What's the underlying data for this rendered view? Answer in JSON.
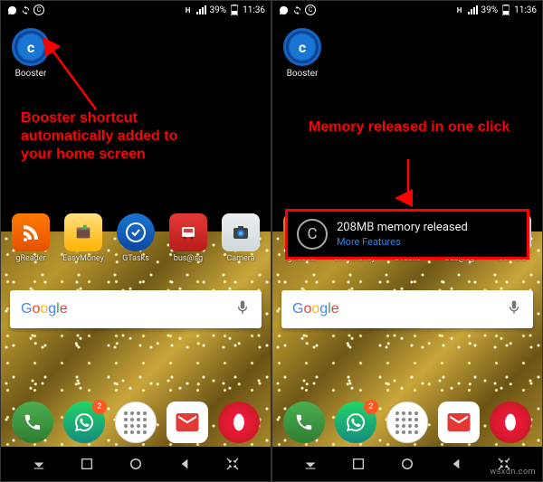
{
  "statusbar": {
    "battery_pct": "39%",
    "time": "11:36"
  },
  "booster": {
    "glyph": "c",
    "label": "Booster"
  },
  "apps": [
    {
      "label": "gReader",
      "class": "greader"
    },
    {
      "label": "EasyMoney",
      "class": "easymoney"
    },
    {
      "label": "GTasks",
      "class": "gtasks"
    },
    {
      "label": "bus@sg",
      "class": "bussg"
    },
    {
      "label": "Camera",
      "class": "camera"
    }
  ],
  "search": {
    "brand": "Google"
  },
  "dock": {
    "whatsapp_badge": "2"
  },
  "annotations": {
    "left": "Booster shortcut automatically added to your home screen",
    "right": "Memory released in one click"
  },
  "toast": {
    "glyph": "C",
    "title": "208MB memory released",
    "link": "More Features"
  },
  "watermark": "wsxdn.com"
}
